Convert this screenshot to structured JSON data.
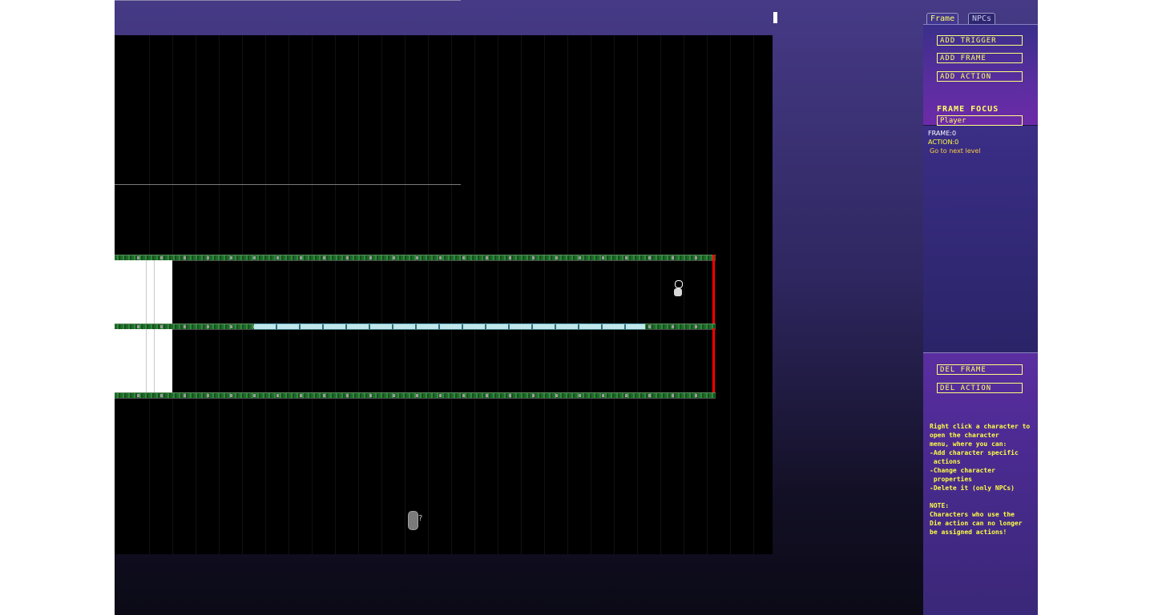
{
  "panel": {
    "tabs": [
      {
        "label": "Frame",
        "active": true
      },
      {
        "label": "NPCs",
        "active": false
      }
    ],
    "buttons": {
      "add_trigger": "ADD TRIGGER",
      "add_frame": "ADD FRAME",
      "add_action": "ADD ACTION",
      "del_frame": "DEL FRAME",
      "del_action": "DEL ACTION"
    },
    "frame_focus": {
      "label": "FRAME FOCUS",
      "value": "Player"
    },
    "info": {
      "frame": "FRAME:0",
      "action": "ACTION:0",
      "item": "Go to next level"
    },
    "help": {
      "lines": [
        "Right click a character to",
        "open the character",
        "menu, where you can:",
        "-Add character specific",
        " actions",
        "-Change character",
        " properties",
        "-Delete it (only NPCs)",
        "",
        "NOTE:",
        "Characters who use the",
        "Die action can no longer",
        "be assigned actions!"
      ]
    }
  },
  "colors": {
    "accent_text": "#ffff66",
    "wall": "#ff0000",
    "platform": "#2e8c3a",
    "glass": "#bfe6ea"
  },
  "icons": {
    "player": "player-character-icon",
    "npc": "npc-character-icon"
  }
}
